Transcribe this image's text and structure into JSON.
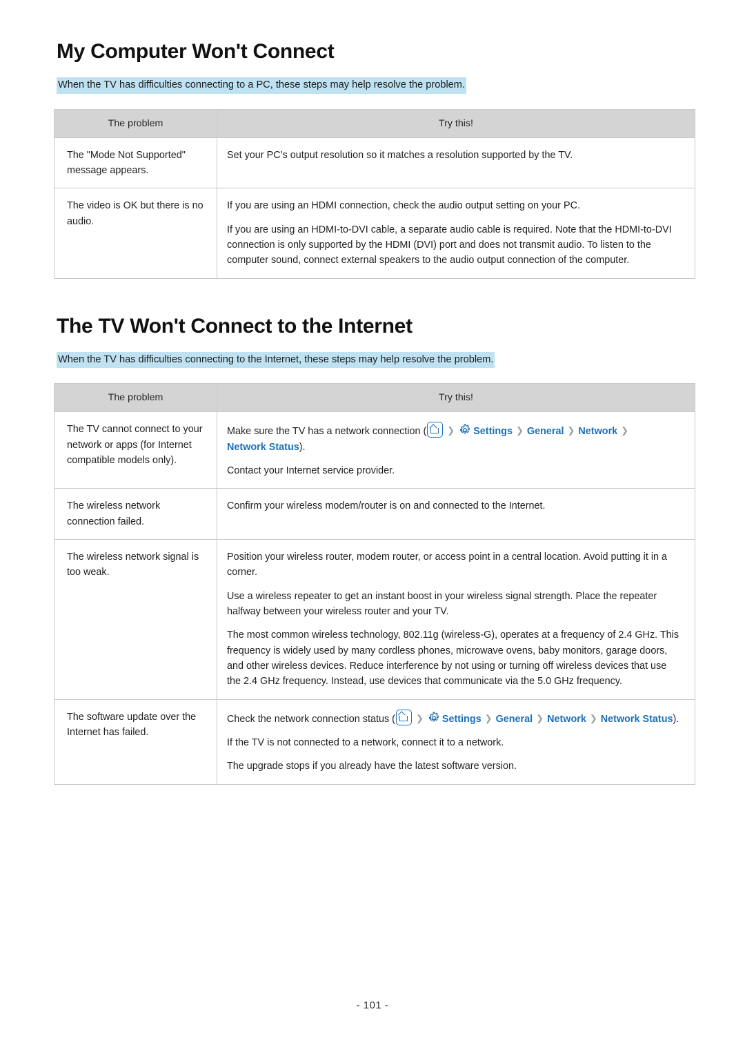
{
  "page": {
    "number": "- 101 -"
  },
  "sections": [
    {
      "title": "My Computer Won't Connect",
      "lead": "When the TV has difficulties connecting to a PC, these steps may help resolve the problem.",
      "headers": [
        "The problem",
        "Try this!"
      ],
      "rows": [
        {
          "problem": "The \"Mode Not Supported\" message appears.",
          "paras": [
            "Set your PC’s output resolution so it matches a resolution supported by the TV."
          ]
        },
        {
          "problem": "The video is OK but there is no audio.",
          "paras": [
            "If you are using an HDMI connection, check the audio output setting on your PC.",
            "If you are using an HDMI-to-DVI cable, a separate audio cable is required. Note that the HDMI-to-DVI connection is only supported by the HDMI (DVI) port and does not transmit audio. To listen to the computer sound, connect external speakers to the audio output connection of the computer."
          ]
        }
      ]
    },
    {
      "title": "The TV Won't Connect to the Internet",
      "lead": "When the TV has difficulties connecting to the Internet, these steps may help resolve the problem.",
      "headers": [
        "The problem",
        "Try this!"
      ],
      "rows": [
        {
          "problem": "The TV cannot connect to your network or apps (for Internet compatible models only).",
          "nav": {
            "prefix": "Make sure the TV has a network connection (",
            "home_icon": "home-icon",
            "gear_icon": "gear-icon",
            "items": [
              "Settings",
              "General",
              "Network",
              "Network Status"
            ],
            "suffix": ")."
          },
          "paras": [
            "Contact your Internet service provider."
          ]
        },
        {
          "problem": "The wireless network connection failed.",
          "paras": [
            "Confirm your wireless modem/router is on and connected to the Internet."
          ]
        },
        {
          "problem": "The wireless network signal is too weak.",
          "paras": [
            "Position your wireless router, modem router, or access point in a central location. Avoid putting it in a corner.",
            "Use a wireless repeater to get an instant boost in your wireless signal strength. Place the repeater halfway between your wireless router and your TV.",
            "The most common wireless technology, 802.11g (wireless-G), operates at a frequency of 2.4 GHz. This frequency is widely used by many cordless phones, microwave ovens, baby monitors, garage doors, and other wireless devices. Reduce interference by not using or turning off wireless devices that use the 2.4 GHz frequency. Instead, use devices that communicate via the 5.0 GHz frequency."
          ]
        },
        {
          "problem": "The software update over the Internet has failed.",
          "nav": {
            "prefix": "Check the network connection status (",
            "home_icon": "home-icon",
            "gear_icon": "gear-icon",
            "items": [
              "Settings",
              "General",
              "Network",
              "Network Status"
            ],
            "suffix": ")."
          },
          "paras": [
            "If the TV is not connected to a network, connect it to a network.",
            "The upgrade stops if you already have the latest software version."
          ]
        }
      ]
    }
  ],
  "colors": {
    "lead_highlight": "#bfe2f2",
    "table_header": "#d4d4d4",
    "link_blue": "#1f6fb5",
    "border": "#c9c9c9"
  }
}
